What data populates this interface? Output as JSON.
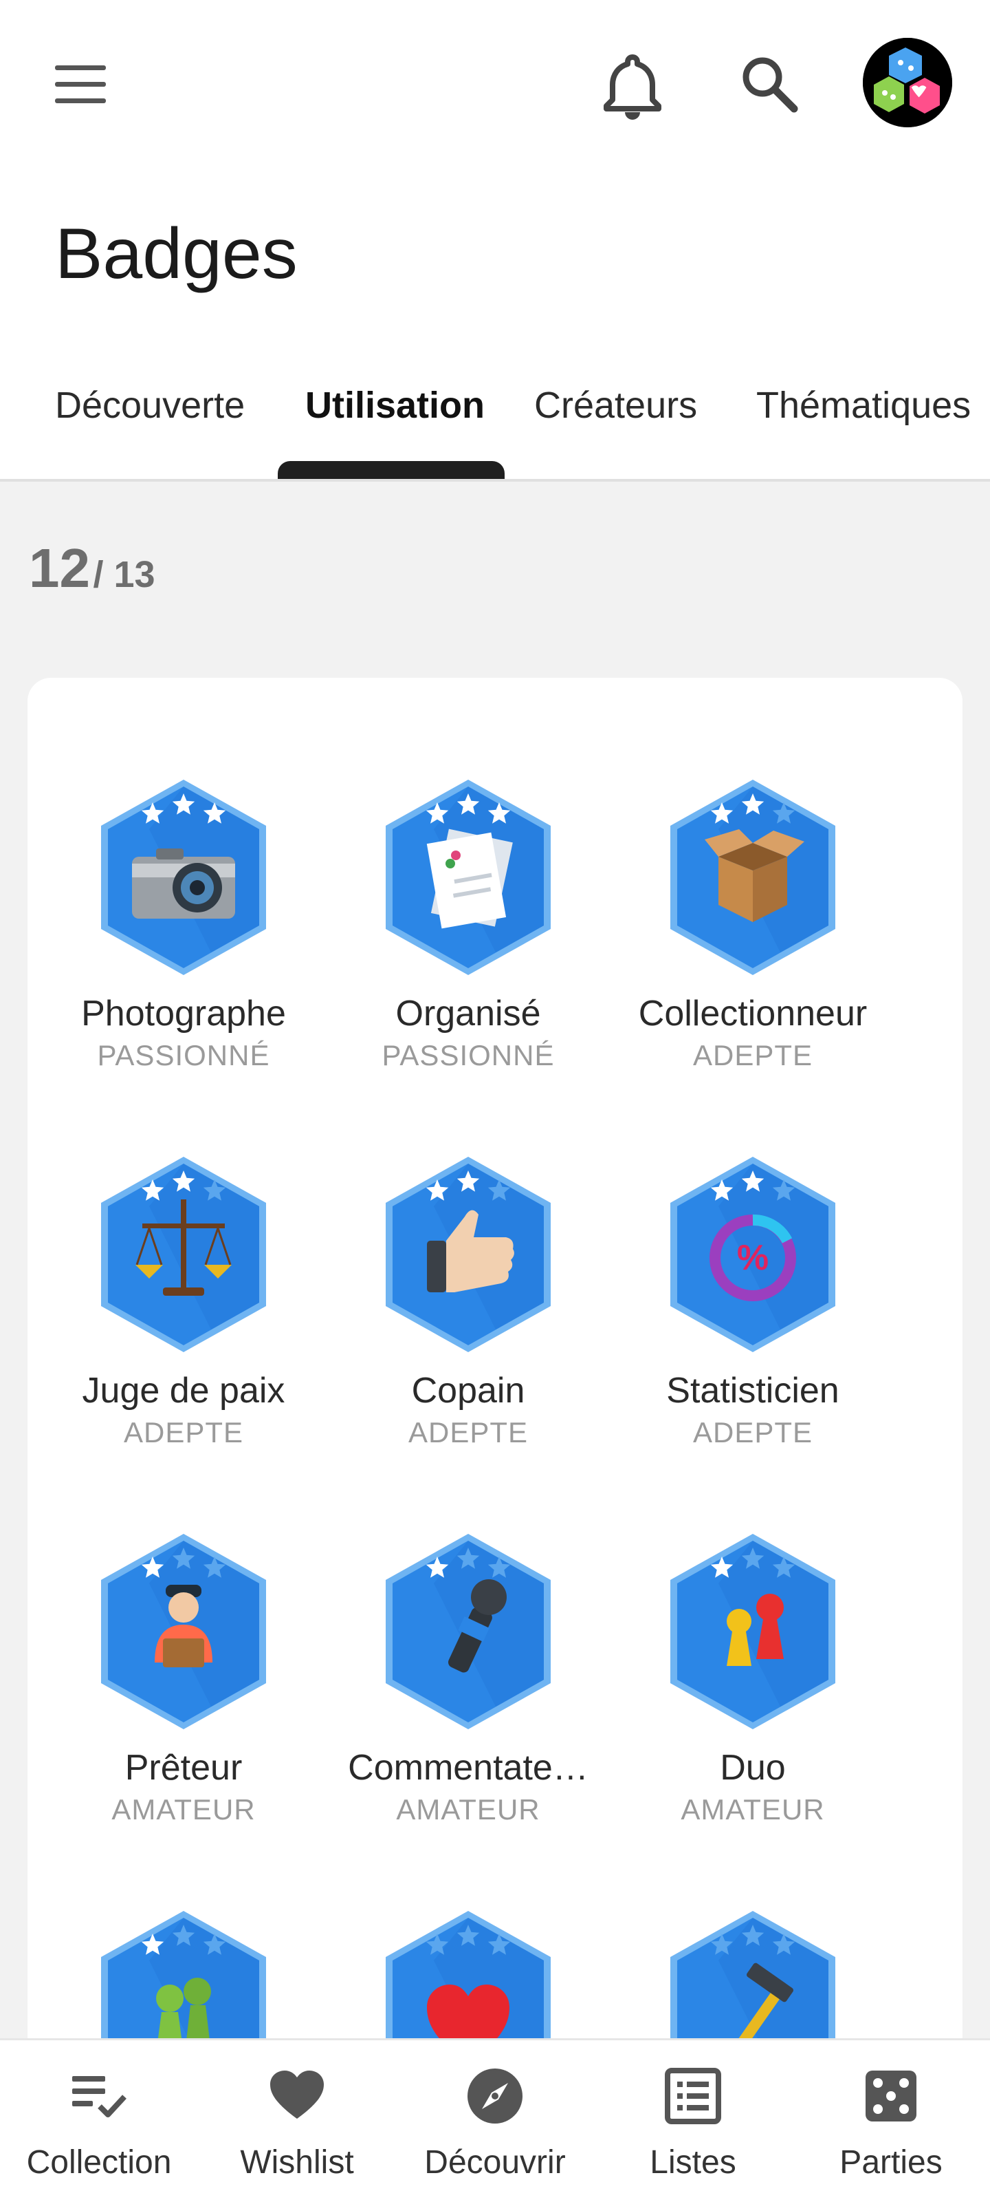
{
  "header": {
    "title": "Badges",
    "menu_icon": "hamburger-menu-icon",
    "notification_icon": "bell-icon",
    "search_icon": "search-icon",
    "avatar_icon": "dice-avatar-icon"
  },
  "tabs": [
    {
      "label": "Découverte",
      "active": false
    },
    {
      "label": "Utilisation",
      "active": true
    },
    {
      "label": "Créateurs",
      "active": false
    },
    {
      "label": "Thématiques",
      "active": false
    }
  ],
  "counter": {
    "earned": "12",
    "total": "/ 13"
  },
  "badges": [
    {
      "name": "Photographe",
      "level": "PASSIONNÉ",
      "icon": "camera-icon",
      "stars": 3
    },
    {
      "name": "Organisé",
      "level": "PASSIONNÉ",
      "icon": "documents-icon",
      "stars": 3
    },
    {
      "name": "Collectionneur",
      "level": "ADEPTE",
      "icon": "open-box-icon",
      "stars": 2
    },
    {
      "name": "Juge de paix",
      "level": "ADEPTE",
      "icon": "scales-icon",
      "stars": 2
    },
    {
      "name": "Copain",
      "level": "ADEPTE",
      "icon": "thumbs-up-icon",
      "stars": 2
    },
    {
      "name": "Statisticien",
      "level": "ADEPTE",
      "icon": "percent-chart-icon",
      "stars": 2
    },
    {
      "name": "Prêteur",
      "level": "AMATEUR",
      "icon": "delivery-person-icon",
      "stars": 1
    },
    {
      "name": "Commentate…",
      "level": "AMATEUR",
      "icon": "microphone-icon",
      "stars": 1
    },
    {
      "name": "Duo",
      "level": "AMATEUR",
      "icon": "two-pawns-icon",
      "stars": 1
    },
    {
      "name": "",
      "level": "",
      "icon": "green-pawns-icon",
      "stars": 1
    },
    {
      "name": "",
      "level": "",
      "icon": "heart-icon",
      "stars": 0
    },
    {
      "name": "",
      "level": "",
      "icon": "hammer-icon",
      "stars": 0
    }
  ],
  "bottom_nav": [
    {
      "label": "Collection",
      "icon": "collection-list-icon"
    },
    {
      "label": "Wishlist",
      "icon": "heart-icon"
    },
    {
      "label": "Découvrir",
      "icon": "compass-icon"
    },
    {
      "label": "Listes",
      "icon": "list-icon"
    },
    {
      "label": "Parties",
      "icon": "dice-icon"
    }
  ],
  "colors": {
    "badge_blue": "#2b86e6",
    "badge_border": "#6fb4f2",
    "star_active": "#ffffff",
    "star_inactive": "#5aa6ee"
  }
}
